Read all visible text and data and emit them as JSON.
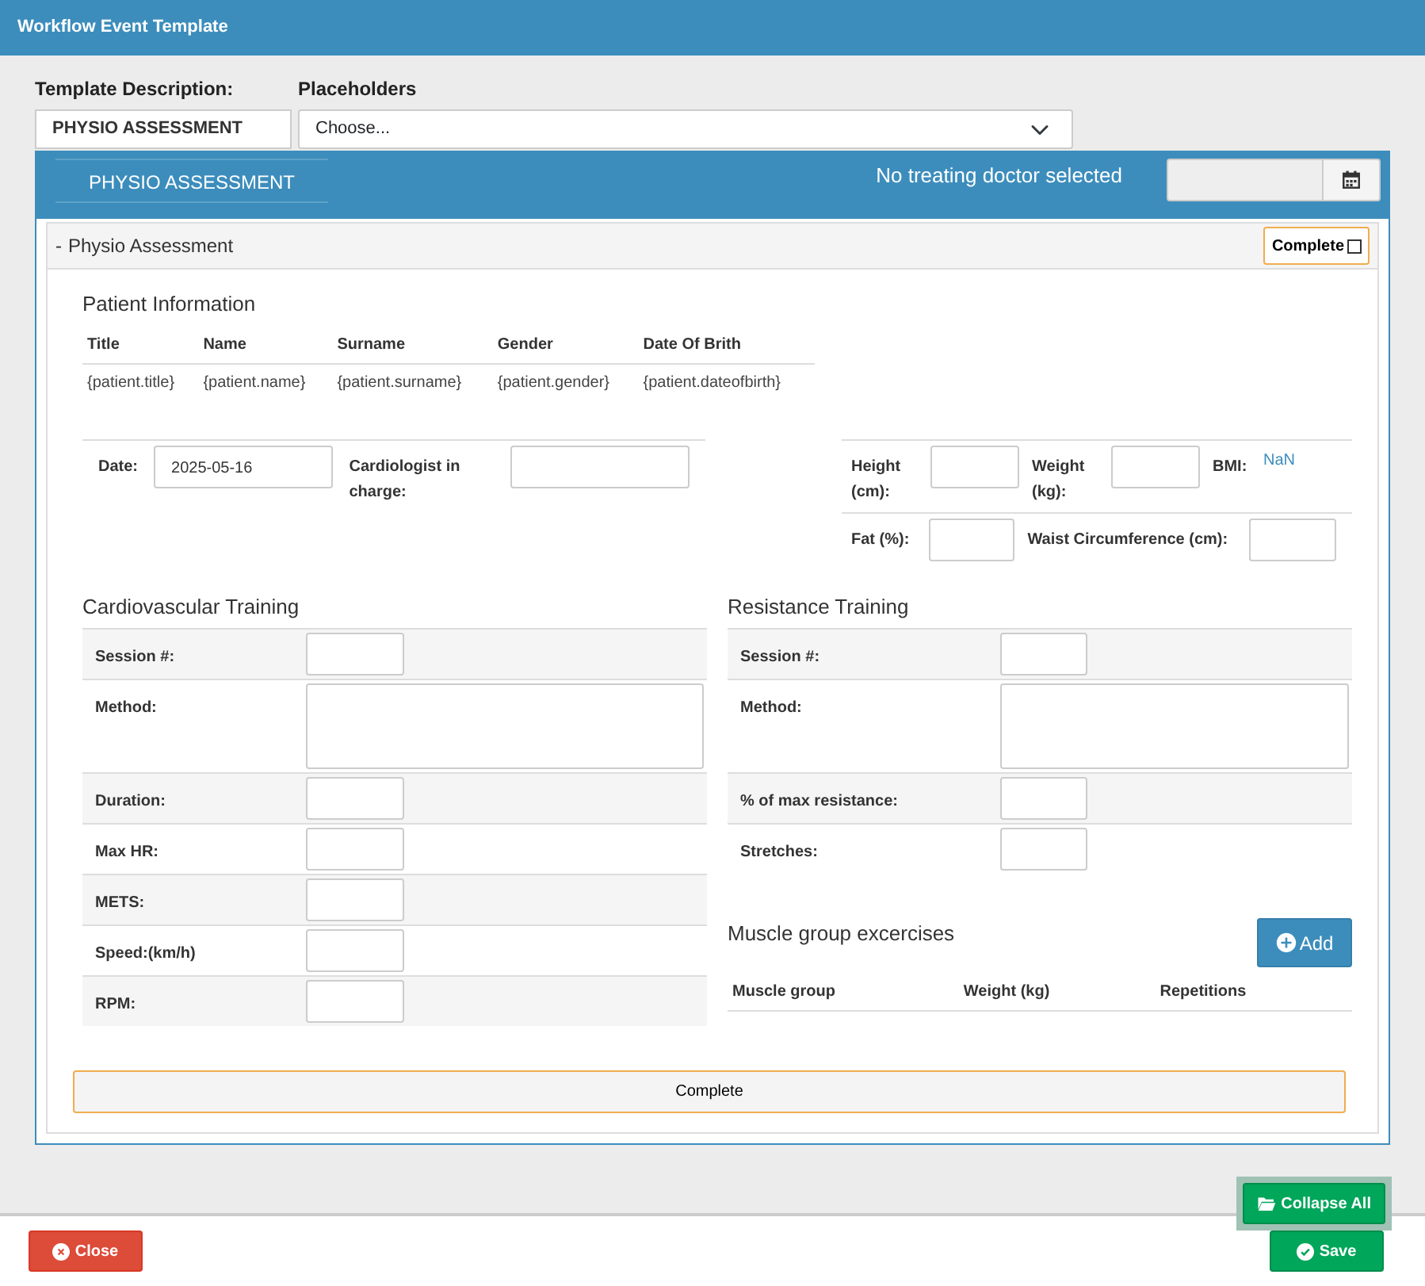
{
  "window": {
    "title": "Workflow Event Template"
  },
  "template_description": {
    "label": "Template Description:",
    "value": "PHYSIO ASSESSMENT"
  },
  "placeholders": {
    "label": "Placeholders",
    "value": "Choose..."
  },
  "panel": {
    "tab": "PHYSIO ASSESSMENT",
    "doctor_status": "No treating doctor selected"
  },
  "section": {
    "toggle": "-",
    "title": "Physio Assessment",
    "complete_label": "Complete",
    "complete_checked": false
  },
  "patient_info": {
    "heading": "Patient Information",
    "columns": [
      "Title",
      "Name",
      "Surname",
      "Gender",
      "Date Of Brith"
    ],
    "values": [
      "{patient.title}",
      "{patient.name}",
      "{patient.surname}",
      "{patient.gender}",
      "{patient.dateofbirth}"
    ]
  },
  "visit": {
    "date_label": "Date:",
    "date_value": "2025-05-16",
    "cardiologist_label": "Cardiologist in charge:"
  },
  "measurements": {
    "rows": [
      [
        {
          "label": "Height (cm):",
          "kind": "input"
        },
        {
          "label": "Weight (kg):",
          "kind": "input"
        },
        {
          "label": "BMI:",
          "kind": "value",
          "value": "NaN"
        }
      ],
      [
        {
          "label": "Fat (%):",
          "kind": "input"
        },
        {
          "label": "Waist Circumference (cm):",
          "kind": "input"
        }
      ]
    ]
  },
  "cardio": {
    "heading": "Cardiovascular Training",
    "rows": [
      {
        "label": "Session #:",
        "kind": "input"
      },
      {
        "label": "Method:",
        "kind": "textarea"
      },
      {
        "label": "Duration:",
        "kind": "input"
      },
      {
        "label": "Max HR:",
        "kind": "input"
      },
      {
        "label": "METS:",
        "kind": "input"
      },
      {
        "label": "Speed:(km/h)",
        "kind": "input"
      },
      {
        "label": "RPM:",
        "kind": "input"
      }
    ]
  },
  "resistance": {
    "heading": "Resistance Training",
    "rows": [
      {
        "label": "Session #:",
        "kind": "input"
      },
      {
        "label": "Method:",
        "kind": "textarea"
      },
      {
        "label": "% of max resistance:",
        "kind": "input"
      },
      {
        "label": "Stretches:",
        "kind": "input"
      }
    ]
  },
  "muscle_groups": {
    "heading": "Muscle group excercises",
    "add_button": "Add",
    "columns": [
      "Muscle group",
      "Weight (kg)",
      "Repetitions"
    ]
  },
  "complete_button": "Complete",
  "collapse_button": "Collapse All",
  "footer": {
    "close_button": "Close",
    "save_button": "Save"
  }
}
